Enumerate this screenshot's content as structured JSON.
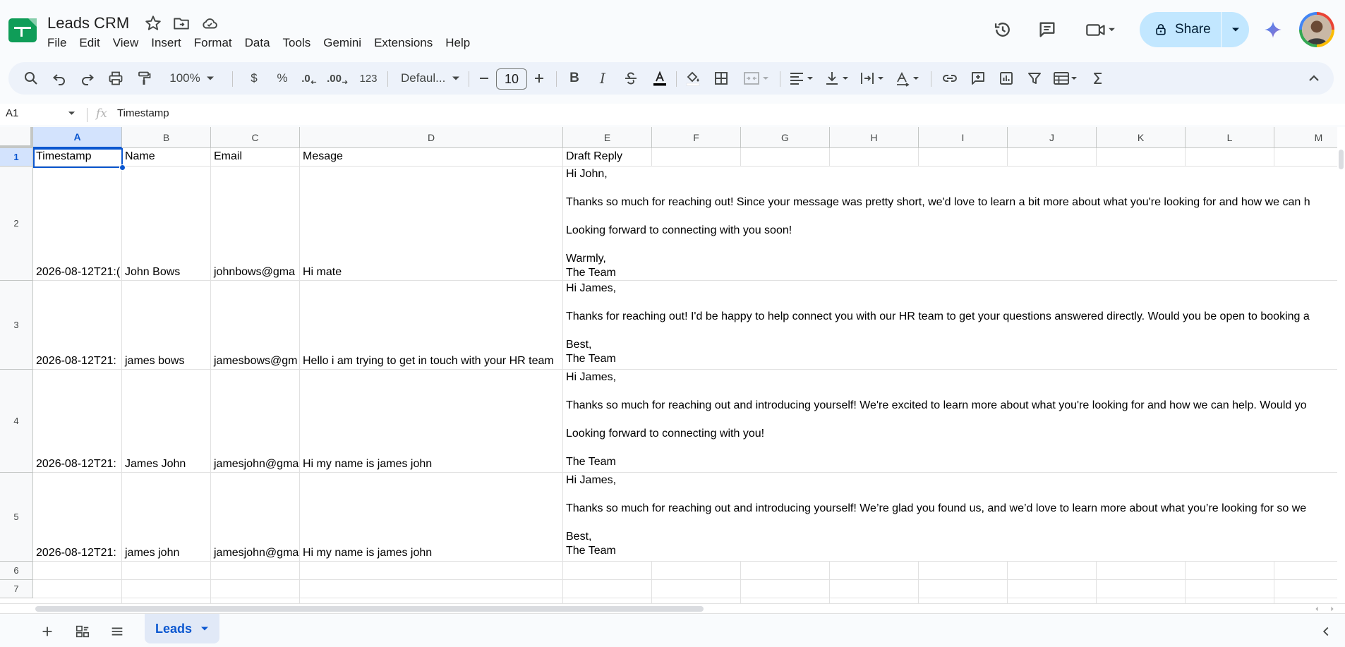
{
  "app": {
    "title": "Leads CRM",
    "menu": [
      "File",
      "Edit",
      "View",
      "Insert",
      "Format",
      "Data",
      "Tools",
      "Gemini",
      "Extensions",
      "Help"
    ],
    "share_label": "Share"
  },
  "toolbar": {
    "zoom": "100%",
    "currency": "$",
    "percent": "%",
    "decrease_decimal": ".0",
    "increase_decimal": ".00",
    "number_format": "123",
    "font": "Defaul...",
    "font_size": "10"
  },
  "formula_bar": {
    "cell_ref": "A1",
    "fx": "fx",
    "value": "Timestamp"
  },
  "columns": [
    "A",
    "B",
    "C",
    "D",
    "E",
    "F",
    "G",
    "H",
    "I",
    "J",
    "K",
    "L",
    "M"
  ],
  "rows": [
    "1",
    "2",
    "3",
    "4",
    "5",
    "6",
    "7"
  ],
  "table": {
    "headers": [
      "Timestamp",
      "Name",
      "Email",
      "Mesage",
      "Draft Reply"
    ],
    "records": [
      {
        "timestamp": "2026-08-12T21:(",
        "name": "John Bows",
        "email": "johnbows@gma",
        "message": "Hi mate",
        "reply": "Hi John,\n\nThanks so much for reaching out! Since your message was pretty short, we'd love to learn a bit more about what you're looking for and how we can h\n\nLooking forward to connecting with you soon!\n\nWarmly,\nThe Team"
      },
      {
        "timestamp": "2026-08-12T21:",
        "name": "james bows",
        "email": "jamesbows@gm",
        "message": "Hello i am trying to get in touch with your HR team",
        "reply": "Hi James,\n\nThanks for reaching out! I'd be happy to help connect you with our HR team to get your questions answered directly. Would you be open to booking a\n\nBest,\nThe Team"
      },
      {
        "timestamp": "2026-08-12T21:",
        "name": "James John",
        "email": "jamesjohn@gma",
        "message": "Hi my name is james john",
        "reply": "Hi James,\n\nThanks so much for reaching out and introducing yourself! We're excited to learn more about what you're looking for and how we can help. Would yo\n\nLooking forward to connecting with you!\n\nThe Team"
      },
      {
        "timestamp": "2026-08-12T21:",
        "name": "james john",
        "email": "jamesjohn@gma",
        "message": "Hi my name is james john",
        "reply": "Hi James,\n\nThanks so much for reaching out and introducing yourself! We’re glad you found us, and we’d love to learn more about what you’re looking for so we\n\nBest,\nThe Team"
      }
    ]
  },
  "sheet_tab": "Leads",
  "colors": {
    "accent": "#0b57d0",
    "share_bg": "#c2e7ff",
    "toolbar_bg": "#edf2fa",
    "header_bg": "#f8f9fa"
  }
}
